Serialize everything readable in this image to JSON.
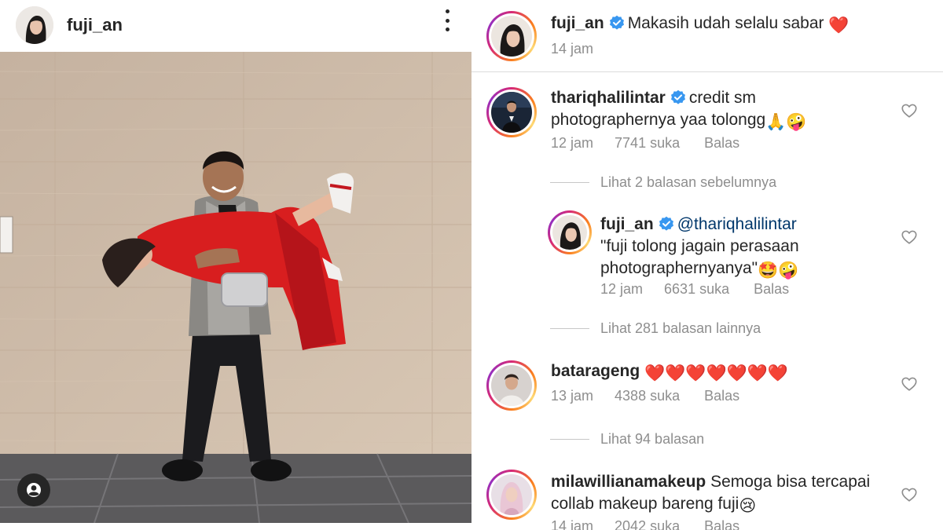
{
  "post": {
    "username": "fuji_an"
  },
  "caption": {
    "username": "fuji_an",
    "text": "Makasih udah selalu sabar",
    "emoji": "❤️",
    "time": "14 jam"
  },
  "comments": [
    {
      "username": "thariqhalilintar",
      "verified": true,
      "line1": "credit sm",
      "line2": "photographernya yaa tolongg",
      "emoji": "🙏🤪",
      "time": "12 jam",
      "likes": "7741 suka",
      "reply": "Balas"
    },
    {
      "username": "batarageng",
      "verified": false,
      "emoji": "❤️❤️❤️❤️❤️❤️❤️",
      "time": "13 jam",
      "likes": "4388 suka",
      "reply": "Balas"
    },
    {
      "username": "milawillianamakeup",
      "verified": false,
      "line1": "Semoga bisa tercapai",
      "line2": "collab makeup bareng fuji",
      "emoji": "😢",
      "time": "14 jam",
      "likes": "2042 suka",
      "reply": "Balas"
    }
  ],
  "reply": {
    "username": "fuji_an",
    "verified": true,
    "mention": "@thariqhalilintar",
    "line1": "\"fuji tolong jagain perasaan",
    "line2": "photographernyanya\"",
    "emoji": "🤩🤪",
    "time": "12 jam",
    "likes": "6631 suka",
    "reply": "Balas"
  },
  "view_replies": {
    "previous": "Lihat 2 balasan sebelumnya",
    "more": "Lihat 281 balasan lainnya",
    "batarageng": "Lihat 94 balasan"
  },
  "colors": {
    "verified": "#3897f0",
    "heart": "#ed4956",
    "muted": "#8e8e8e",
    "text": "#262626"
  },
  "icons": {
    "more": "more-vertical-icon",
    "tag": "user-tag-icon",
    "like": "heart-outline-icon",
    "verified": "verified-badge-icon"
  }
}
